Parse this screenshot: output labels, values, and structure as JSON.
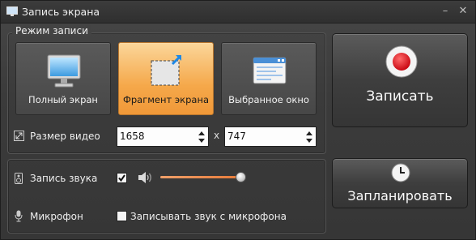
{
  "window": {
    "title": "Запись экрана",
    "controls": {
      "minimize": "–",
      "close": "✕"
    }
  },
  "mode_group": {
    "label": "Режим записи",
    "options": [
      {
        "label": "Полный экран",
        "icon": "monitor-icon",
        "selected": false
      },
      {
        "label": "Фрагмент экрана",
        "icon": "screen-fragment-icon",
        "selected": true
      },
      {
        "label": "Выбранное окно",
        "icon": "window-icon",
        "selected": false
      }
    ]
  },
  "video_size": {
    "label": "Размер видео",
    "width": "1658",
    "height": "747",
    "separator": "x",
    "icon": "resize-icon"
  },
  "sound": {
    "label": "Запись звука",
    "enabled": true,
    "icon": "speaker-icon",
    "volume_icon": "volume-icon",
    "volume": 1.0
  },
  "microphone": {
    "label": "Микрофон",
    "icon": "microphone-icon",
    "checkbox_label": "Записывать звук с микрофона",
    "enabled": false
  },
  "actions": {
    "record_label": "Записать",
    "schedule_label": "Запланировать"
  },
  "colors": {
    "accent": "#f5a84a",
    "record": "#e8101a",
    "slider": "#e77a38"
  }
}
